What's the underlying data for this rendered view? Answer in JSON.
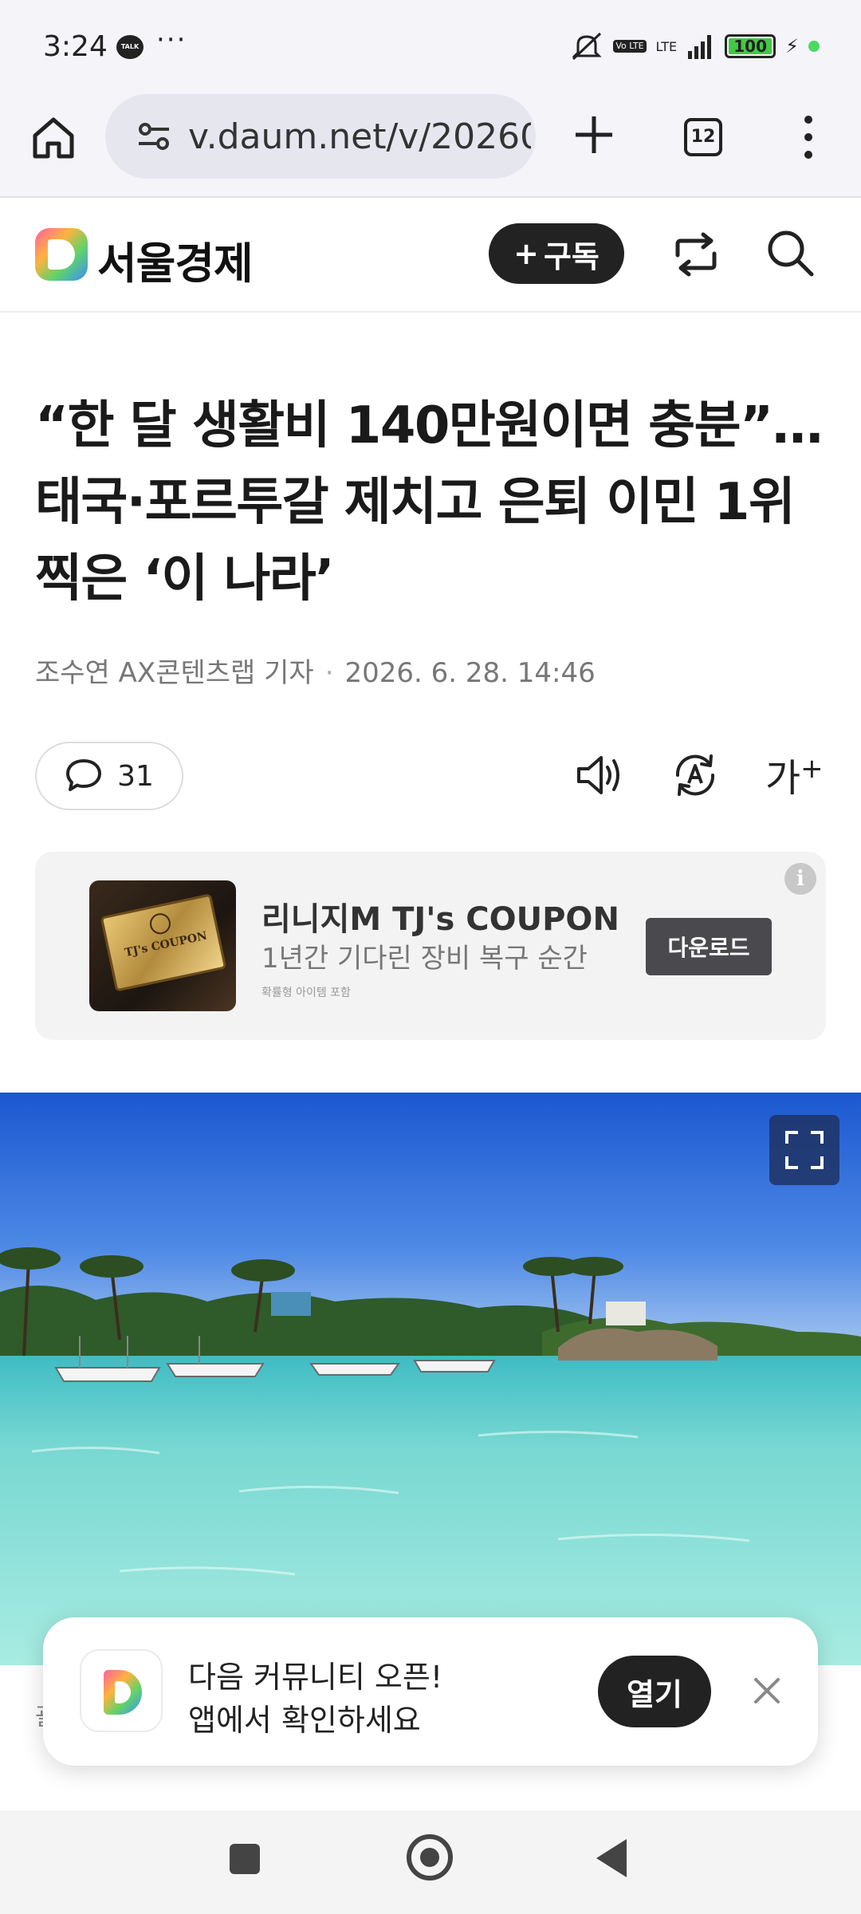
{
  "status_bar": {
    "time": "3:24",
    "talk_badge": "TALK",
    "more_dots": "···",
    "volte": "Vo LTE",
    "network": "LTE",
    "battery": "100",
    "icons": [
      "kakaotalk-icon",
      "mute-icon",
      "volte-icon",
      "signal-icon",
      "battery-icon",
      "charging-icon"
    ]
  },
  "browser": {
    "url": "v.daum.net/v/20260",
    "tab_count": "12",
    "icons": [
      "home-icon",
      "site-settings-icon",
      "new-tab-icon",
      "tabs-icon",
      "menu-icon"
    ]
  },
  "site_header": {
    "site_name": "서울경제",
    "subscribe_label": "구독",
    "icons": [
      "daum-logo-icon",
      "plus-icon",
      "share-icon",
      "search-icon"
    ]
  },
  "article": {
    "headline": "“한 달 생활비 140만원이면 충분”…태국·포르투갈 제치고 은퇴 이민 1위 찍은 ‘이 나라’",
    "author": "조수연 AX콘텐츠랩 기자",
    "separator": "·",
    "date": "2026. 6. 28. 14:46",
    "comment_count": "31",
    "font_size_label": "가",
    "font_size_plus": "+",
    "icons": [
      "comment-icon",
      "tts-speaker-icon",
      "translate-icon",
      "font-size-icon"
    ]
  },
  "ad": {
    "title": "리니지M TJ's COUPON",
    "description": "1년간 기다린 장비 복구 순간",
    "note": "확률형 아이템 포함",
    "download_label": "다운로드",
    "info_label": "i",
    "thumb_text": "TJ's COUPON",
    "thumb_emblem": "TJ"
  },
  "photo": {
    "icons": [
      "fullscreen-icon"
    ]
  },
  "caption_peek": "괄",
  "toast": {
    "line1": "다음 커뮤니티 오픈!",
    "line2": "앱에서 확인하세요",
    "open_label": "열기",
    "icons": [
      "daum-app-icon",
      "close-icon"
    ]
  },
  "nav_bar": {
    "icons": [
      "recents-icon",
      "home-button-icon",
      "back-icon"
    ]
  },
  "colors": {
    "status_bg": "#f4f4f9",
    "dark_button": "#222222",
    "ad_bg": "#f3f3f3",
    "ad_button": "#4a4a4e",
    "sky": "#1f5fd4",
    "water": "#7fd8d0"
  }
}
